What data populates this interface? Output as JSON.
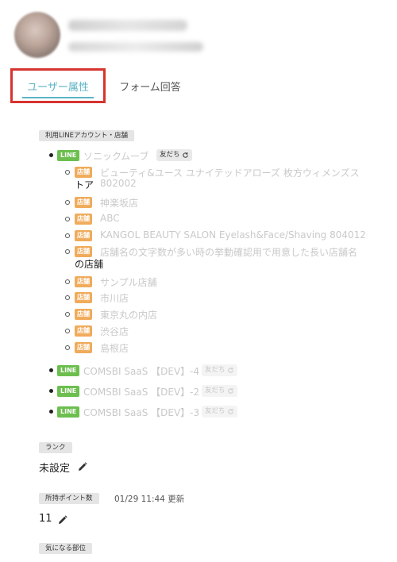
{
  "tabs": {
    "user_attributes": "ユーザー属性",
    "form_answers": "フォーム回答"
  },
  "section_accounts": {
    "label": "利用LINEアカウント・店舗",
    "line_badge": "LINE",
    "store_badge": "店舗",
    "friend_label": "友だち",
    "accounts": [
      {
        "name": "ソニックムーブ",
        "stores": [
          {
            "line1": "ビューティ&ユース ユナイテッドアローズ 枚方ウィメンズス",
            "line2": "802002",
            "overflow": "トア"
          },
          {
            "line1": "神楽坂店"
          },
          {
            "line1": "ABC"
          },
          {
            "line1": "KANGOL BEAUTY SALON Eyelash&Face/Shaving 804012"
          },
          {
            "line1": "店舗名の文字数が多い時の挙動確認用で用意した長い店舗名",
            "overflow": "の店舗"
          },
          {
            "line1": "サンプル店舗"
          },
          {
            "line1": "市川店"
          },
          {
            "line1": "東京丸の内店"
          },
          {
            "line1": "渋谷店"
          },
          {
            "line1": "島根店"
          }
        ]
      },
      {
        "name": "COMSBI SaaS 【DEV】-4"
      },
      {
        "name": "COMSBI SaaS 【DEV】-2"
      },
      {
        "name": "COMSBI SaaS 【DEV】-3"
      }
    ]
  },
  "section_rank": {
    "label": "ランク",
    "value": "未設定"
  },
  "section_points": {
    "label": "所持ポイント数",
    "updated": "01/29 11:44 更新",
    "value": "11"
  },
  "section_concern": {
    "label": "気になる部位"
  },
  "icons": {
    "edit": "pencil-icon",
    "sync": "sync-icon",
    "avatar": "avatar"
  },
  "colors": {
    "accent": "#5bb3c4",
    "highlight_box": "#d6342e",
    "line_green": "#6cbf4e",
    "store_orange": "#f0ab5b"
  }
}
